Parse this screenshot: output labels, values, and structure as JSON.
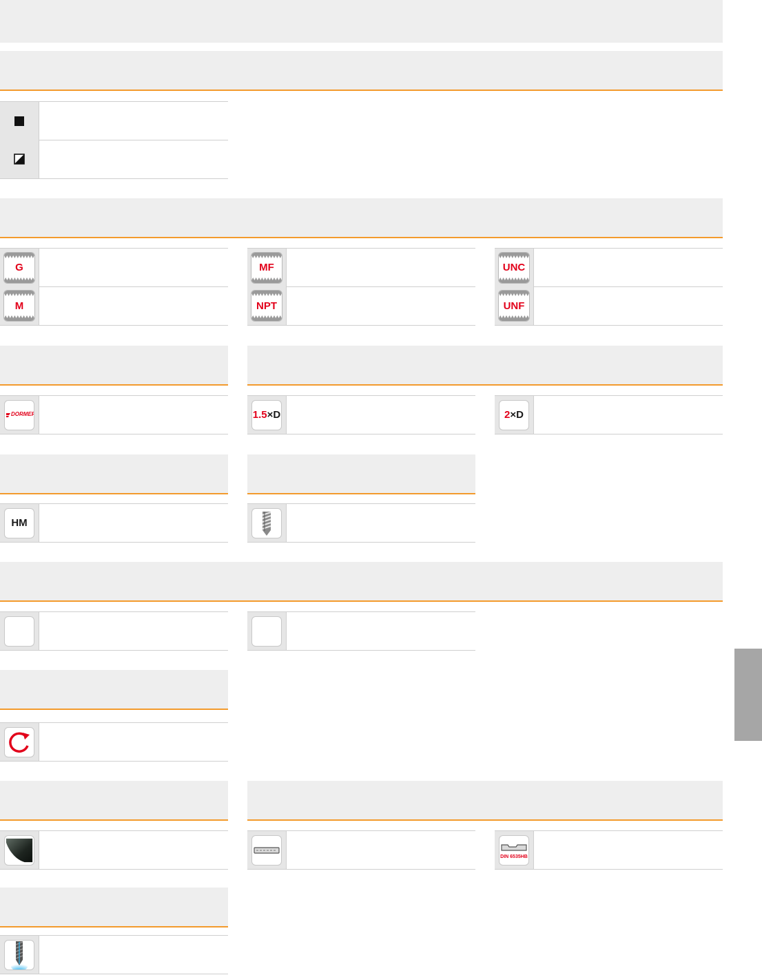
{
  "thread_types": [
    "G",
    "MF",
    "UNC",
    "M",
    "NPT",
    "UNF"
  ],
  "brand": {
    "logo_text": "DORMER"
  },
  "depth_icons": [
    {
      "num": "1.5",
      "rest": "×D"
    },
    {
      "num": "2",
      "rest": "×D"
    }
  ],
  "material": {
    "label": "HM"
  },
  "shank": {
    "din_label": "DIN 6535HB"
  }
}
